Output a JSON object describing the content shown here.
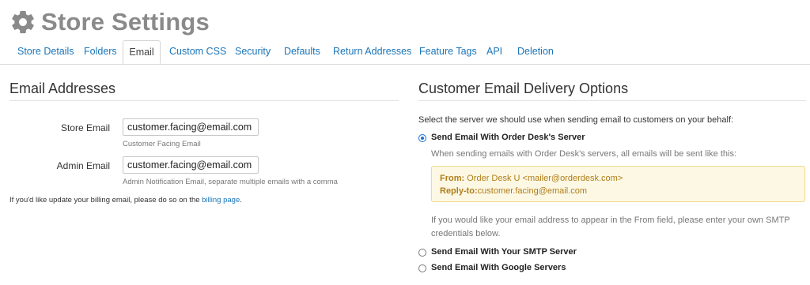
{
  "page": {
    "title": "Store Settings"
  },
  "tabs": [
    {
      "label": "Store Details"
    },
    {
      "label": "Folders"
    },
    {
      "label": "Email",
      "active": true
    },
    {
      "label": "Custom CSS"
    },
    {
      "label": "Security"
    },
    {
      "label": "Defaults"
    },
    {
      "label": "Return Addresses"
    },
    {
      "label": "Feature Tags"
    },
    {
      "label": "API"
    },
    {
      "label": "Deletion"
    }
  ],
  "email_addresses": {
    "heading": "Email Addresses",
    "store_email": {
      "label": "Store Email",
      "value": "customer.facing@email.com",
      "hint": "Customer Facing Email"
    },
    "admin_email": {
      "label": "Admin Email",
      "value": "customer.facing@email.com",
      "hint": "Admin Notification Email, separate multiple emails with a comma"
    },
    "billing_note": "If you'd like update your billing email, please do so on the",
    "billing_link": "billing page",
    "billing_end": "."
  },
  "delivery": {
    "heading": "Customer Email Delivery Options",
    "intro": "Select the server we should use when sending email to customers on your behalf:",
    "options": [
      {
        "label": "Send Email With Order Desk's Server",
        "selected": true
      },
      {
        "label": "Send Email With Your SMTP Server",
        "selected": false
      },
      {
        "label": "Send Email With Google Servers",
        "selected": false
      }
    ],
    "order_desk_desc": "When sending emails with Order Desk's servers, all emails will be sent like this:",
    "from_label": "From:",
    "from_value": "Order Desk U <mailer@orderdesk.com>",
    "reply_label": "Reply-to:",
    "reply_value": "customer.facing@email.com",
    "smtp_note": "If you would like your email address to appear in the From field, please enter your own SMTP credentials below."
  },
  "colors": {
    "link": "#1a75b8",
    "notice_bg": "#fcf8e3",
    "notice_text": "#b07d1a",
    "radio_selected": "#1a6fd8"
  }
}
